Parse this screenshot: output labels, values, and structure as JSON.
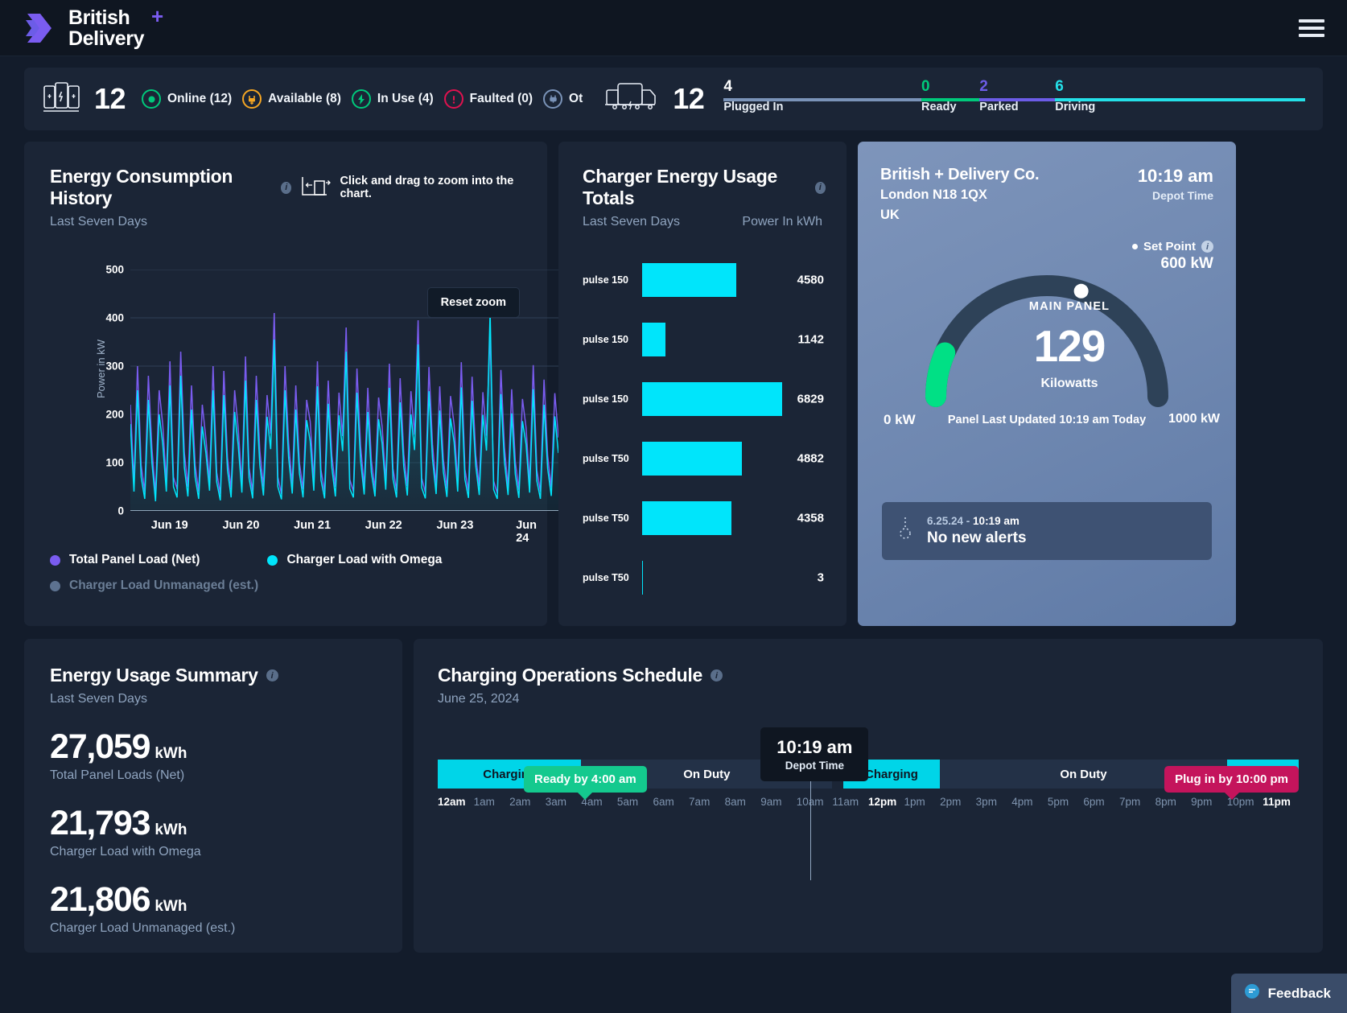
{
  "brand": {
    "line1": "British",
    "line2": "Delivery",
    "plus": "+",
    "logo_icon": "chevron-logo-icon",
    "menu_icon": "hamburger-menu-icon"
  },
  "status": {
    "charger_icon": "charger-stack-icon",
    "charger_total": "12",
    "items": [
      {
        "icon": "online-circle-icon",
        "label": "Online (12)",
        "color": "#00c97b"
      },
      {
        "icon": "plug-down-icon",
        "label": "Available (8)",
        "color": "#f5a623"
      },
      {
        "icon": "bolt-icon",
        "label": "In Use (4)",
        "color": "#00c97b"
      },
      {
        "icon": "alert-exclaim-icon",
        "label": "Faulted (0)",
        "color": "#e01martin"
      },
      {
        "icon": "plug-icon",
        "label": "Ot",
        "color": "#7a93b8"
      }
    ],
    "faulted_color": "#e0124f",
    "vehicle_icon": "delivery-van-icon",
    "vehicle_total": "12",
    "segments": [
      {
        "num": "4",
        "label": "Plugged In",
        "color": "#7a93b8",
        "width": 34
      },
      {
        "num": "0",
        "label": "Ready",
        "color": "#00c97b",
        "width": 10
      },
      {
        "num": "2",
        "label": "Parked",
        "color": "#6c5ce7",
        "width": 13
      },
      {
        "num": "6",
        "label": "Driving",
        "color": "#24e0e8",
        "width": 43
      }
    ]
  },
  "energy_history": {
    "title": "Energy Consumption History",
    "info_icon": "info-icon",
    "zoom_icon": "drag-zoom-icon",
    "hint": "Click and drag to zoom into the chart.",
    "subtitle": "Last Seven Days",
    "reset_zoom": "Reset zoom",
    "legend": [
      {
        "label": "Total Panel Load (Net)",
        "color": "#7a5cf0",
        "enabled": true
      },
      {
        "label": "Charger Load with Omega",
        "color": "#00e5fb",
        "enabled": true
      },
      {
        "label": "Charger Load Unmanaged (est.)",
        "color": "#5d7290",
        "enabled": false
      }
    ]
  },
  "chart_data": {
    "type": "area",
    "title": "Energy Consumption History",
    "subtitle": "Last Seven Days",
    "xlabel": "",
    "ylabel": "Power in kW",
    "ylim": [
      0,
      500
    ],
    "yticks": [
      0,
      100,
      200,
      300,
      400,
      500
    ],
    "categories": [
      "Jun 19",
      "Jun 20",
      "Jun 21",
      "Jun 22",
      "Jun 23",
      "Jun 24"
    ],
    "grid": true,
    "legend_position": "bottom",
    "series": [
      {
        "name": "Total Panel Load (Net)",
        "color": "#7a5cf0",
        "values": [
          220,
          60,
          300,
          95,
          40,
          280,
          130,
          35,
          250,
          180,
          60,
          310,
          70,
          45,
          330,
          120,
          50,
          260,
          95,
          40,
          220,
          150,
          60,
          300,
          80,
          35,
          290,
          110,
          45,
          250,
          170,
          55,
          320,
          90,
          40,
          280,
          125,
          50,
          240,
          160,
          410,
          70,
          35,
          300,
          140,
          55,
          260,
          100,
          45,
          230,
          185,
          60,
          310,
          85,
          40,
          270,
          115,
          50,
          245,
          155,
          380,
          65,
          40,
          295,
          135,
          50,
          255,
          105,
          45,
          235,
          175,
          60,
          305,
          88,
          42,
          275,
          118,
          52,
          248,
          158,
          395,
          68,
          38,
          298,
          138,
          52,
          258,
          108,
          46,
          238,
          178,
          58,
          308,
          86,
          41,
          278,
          116,
          51,
          246,
          156,
          370,
          62,
          36,
          292,
          132,
          48,
          252,
          102,
          44,
          232,
          172,
          56,
          302,
          84,
          40,
          272,
          114,
          49,
          244,
          152
        ]
      },
      {
        "name": "Charger Load with Omega",
        "color": "#00e5fb",
        "values": [
          180,
          40,
          250,
          70,
          25,
          230,
          100,
          20,
          200,
          140,
          40,
          260,
          50,
          28,
          280,
          90,
          30,
          210,
          70,
          25,
          175,
          120,
          42,
          250,
          60,
          22,
          240,
          85,
          28,
          205,
          135,
          38,
          270,
          68,
          26,
          230,
          95,
          32,
          195,
          128,
          355,
          50,
          24,
          250,
          110,
          36,
          210,
          78,
          28,
          188,
          145,
          42,
          258,
          64,
          26,
          222,
          90,
          30,
          198,
          124,
          330,
          46,
          28,
          245,
          105,
          34,
          205,
          80,
          30,
          190,
          140,
          44,
          255,
          66,
          28,
          225,
          92,
          32,
          200,
          126,
          345,
          48,
          26,
          248,
          108,
          35,
          208,
          82,
          29,
          192,
          142,
          40,
          256,
          65,
          27,
          228,
          94,
          33,
          199,
          125,
          412,
          44,
          25,
          242,
          102,
          33,
          202,
          76,
          27,
          186,
          138,
          38,
          252,
          62,
          25,
          220,
          88,
          31,
          196,
          120
        ]
      }
    ]
  },
  "charger_totals": {
    "title": "Charger Energy Usage Totals",
    "info_icon": "info-icon",
    "subtitle": "Last Seven Days",
    "unit_label": "Power In kWh",
    "max": 6829,
    "bars": [
      {
        "label": "pulse 150",
        "value": 4580
      },
      {
        "label": "pulse 150",
        "value": 1142
      },
      {
        "label": "pulse 150",
        "value": 6829
      },
      {
        "label": "pulse T50",
        "value": 4882
      },
      {
        "label": "pulse T50",
        "value": 4358
      },
      {
        "label": "pulse T50",
        "value": 3
      }
    ]
  },
  "panel": {
    "company": "British + Delivery Co.",
    "address1": "London N18 1QX",
    "address2": "UK",
    "time": "10:19 am",
    "time_label": "Depot Time",
    "setpoint_label": "Set Point",
    "setpoint_info_icon": "info-icon",
    "setpoint_value": "600 kW",
    "gauge_name": "MAIN PANEL",
    "gauge_value": "129",
    "gauge_unit": "Kilowatts",
    "gauge_min": "0 kW",
    "gauge_max": "1000 kW",
    "updated_prefix": "Panel Last Updated ",
    "updated_time": "10:19 am Today",
    "gauge_numeric": 129,
    "gauge_range_max": 1000,
    "setpoint_numeric": 600,
    "arc_color": "#2e4258",
    "fill_color": "#00e085",
    "alert_icon": "alert-bell-icon",
    "alert_date": "6.25.24 - ",
    "alert_time": "10:19 am",
    "alert_message": "No new alerts"
  },
  "usage_summary": {
    "title": "Energy Usage Summary",
    "info_icon": "info-icon",
    "subtitle": "Last Seven Days",
    "metrics": [
      {
        "num": "27,059",
        "unit": "kWh",
        "label": "Total Panel Loads (Net)"
      },
      {
        "num": "21,793",
        "unit": "kWh",
        "label": "Charger Load with Omega"
      },
      {
        "num": "21,806",
        "unit": "kWh",
        "label": "Charger Load Unmanaged (est.)"
      }
    ]
  },
  "schedule": {
    "title": "Charging Operations Schedule",
    "info_icon": "info-icon",
    "subtitle": "June 25, 2024",
    "ready_pill": "Ready by 4:00 am",
    "ready_color": "#14c98e",
    "plugin_pill": "Plug in by 10:00 pm",
    "plugin_color": "#c4145c",
    "now_time": "10:19 am",
    "now_label": "Depot Time",
    "segments": [
      {
        "label": "Charging",
        "type": "charging",
        "hours": 4
      },
      {
        "label": "On Duty",
        "type": "duty",
        "hours": 7
      },
      {
        "label": "",
        "type": "gap",
        "hours": 0.3
      },
      {
        "label": "Charging",
        "type": "charging",
        "hours": 2.7
      },
      {
        "label": "On Duty",
        "type": "duty",
        "hours": 8
      },
      {
        "label": "Charging",
        "type": "charging",
        "hours": 2
      }
    ],
    "hours": [
      "12am",
      "1am",
      "2am",
      "3am",
      "4am",
      "5am",
      "6am",
      "7am",
      "8am",
      "9am",
      "10am",
      "11am",
      "12pm",
      "1pm",
      "2pm",
      "3pm",
      "4pm",
      "5pm",
      "6pm",
      "7pm",
      "8pm",
      "9pm",
      "10pm",
      "11pm"
    ],
    "active_hours": [
      "12am",
      "12pm",
      "11pm"
    ],
    "charging_color": "#00d5e8"
  },
  "feedback": {
    "label": "Feedback",
    "icon": "feedback-circle-icon"
  }
}
